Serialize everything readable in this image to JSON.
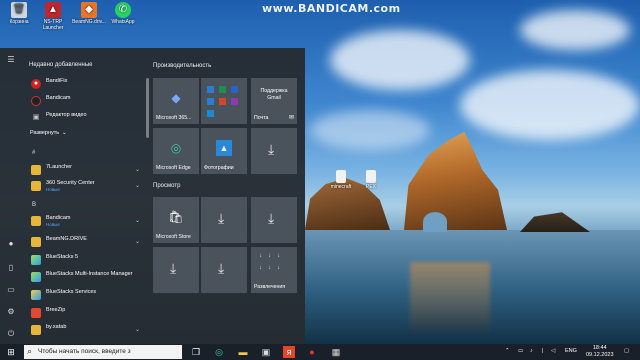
{
  "watermark": "www.BANDICAM.com",
  "desktop_icons": [
    {
      "label": "Корзина"
    },
    {
      "label": "NS-TRP Launcher"
    },
    {
      "label": "BeamNG.driv..."
    },
    {
      "label": "WhatsApp"
    }
  ],
  "desktop_files": [
    {
      "label": "minecraft"
    },
    {
      "label": "PEX"
    }
  ],
  "start_menu": {
    "recent_title": "Недавно добавленные",
    "recent": [
      {
        "label": "BandiFix"
      },
      {
        "label": "Bandicam"
      },
      {
        "label": "Редактор видео"
      }
    ],
    "expand_label": "Развернуть",
    "hash_letter": "#",
    "b_letter": "B",
    "apps": [
      {
        "label": "7Launcher",
        "sub": ""
      },
      {
        "label": "360 Security Center",
        "sub": "Новые"
      },
      {
        "label": "Bandicam",
        "sub": "Новые"
      },
      {
        "label": "BeamNG.DRIVE",
        "sub": ""
      },
      {
        "label": "BlueStacks 5",
        "sub": ""
      },
      {
        "label": "BlueStacks Multi-Instance Manager",
        "sub": ""
      },
      {
        "label": "BlueStacks Services",
        "sub": ""
      },
      {
        "label": "BreeZip",
        "sub": ""
      },
      {
        "label": "by.xatab",
        "sub": ""
      }
    ],
    "group_productivity": "Производительность",
    "group_browse": "Просмотр",
    "tiles": {
      "office": "Microsoft 365...",
      "gmail_line1": "Поддержка",
      "gmail_line2": "Gmail",
      "mail": "Почта",
      "edge": "Microsoft Edge",
      "photos": "Фотографии",
      "store": "Microsoft Store",
      "play": "Развлечения"
    }
  },
  "taskbar": {
    "search_placeholder": "Чтобы начать поиск, введите з",
    "language": "ENG",
    "time": "18:44",
    "date": "09.12.2023"
  }
}
